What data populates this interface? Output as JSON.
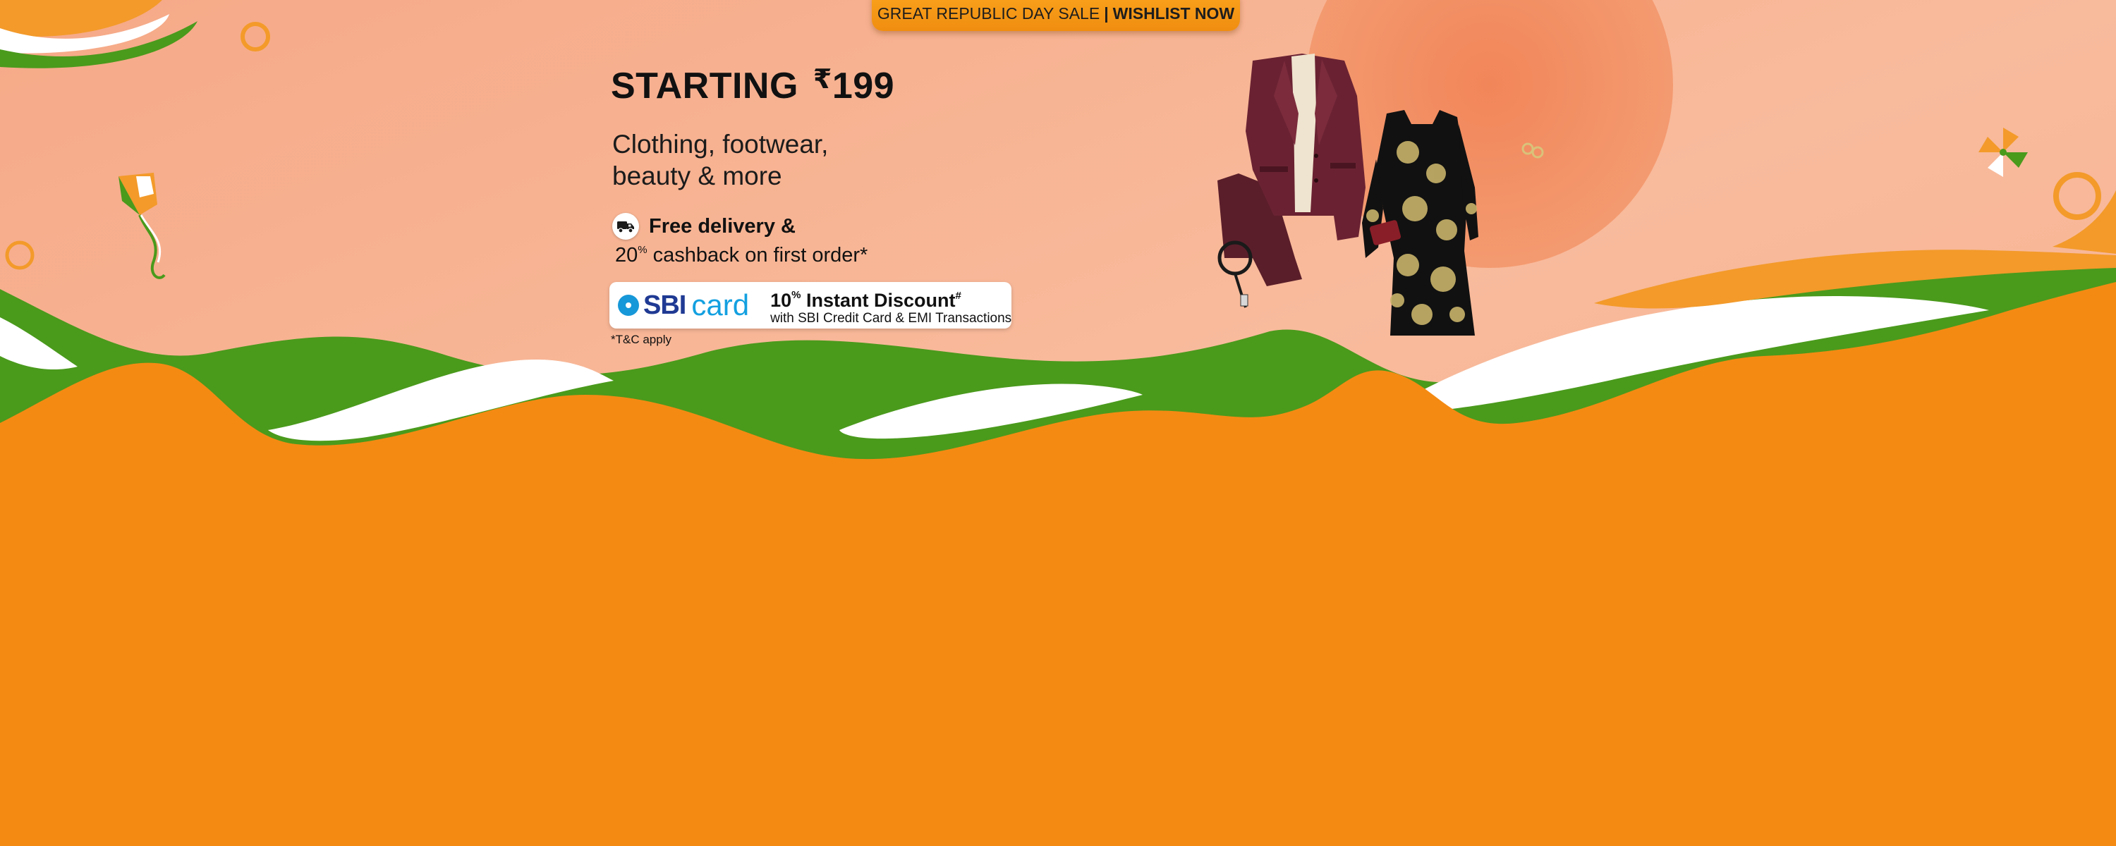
{
  "top_banner": {
    "sale_label": "GREAT REPUBLIC DAY SALE",
    "separator": "|",
    "cta_label": "WISHLIST NOW"
  },
  "hero": {
    "headline_prefix": "STARTING",
    "currency_symbol": "₹",
    "price": "199",
    "subtitle_line1": "Clothing, footwear,",
    "subtitle_line2": "beauty & more",
    "delivery_text": "Free delivery &",
    "delivery_icon": "truck-icon",
    "cashback_value": "20",
    "cashback_unit": "%",
    "cashback_text": "cashback on first order*",
    "terms_text": "*T&C apply"
  },
  "offer": {
    "brand_sbi": "SBI",
    "brand_card": "card",
    "discount_value": "10",
    "discount_unit": "%",
    "discount_label": "Instant Discount",
    "discount_mark": "#",
    "discount_sub": "with SBI Credit Card & EMI Transactions"
  },
  "colors": {
    "saffron": "#f48a12",
    "green": "#4a9a1c",
    "peach_background": "#f7b796",
    "sun": "#f28a5f",
    "brand_blue": "#1f3a93",
    "brand_light_blue": "#13a0e0"
  },
  "decorations": [
    "kite-icon",
    "pinwheel-icon",
    "blazer-image",
    "dress-image",
    "belt-image",
    "clutch-image"
  ]
}
